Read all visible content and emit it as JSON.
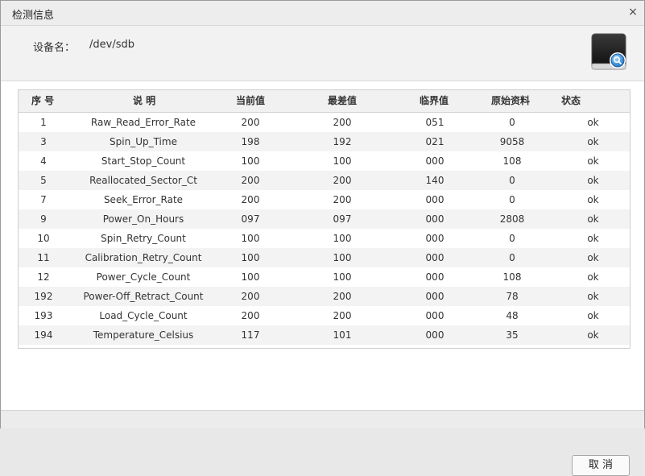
{
  "dialog": {
    "title": "检测信息",
    "close_icon": "×"
  },
  "device": {
    "label": "设备名：",
    "value": "/dev/sdb",
    "icon": "disk-search-icon"
  },
  "table": {
    "headers": [
      "序 号",
      "说 明",
      "当前值",
      "最差值",
      "临界值",
      "原始资料",
      "状态"
    ],
    "rows": [
      [
        "1",
        "Raw_Read_Error_Rate",
        "200",
        "200",
        "051",
        "0",
        "ok"
      ],
      [
        "3",
        "Spin_Up_Time",
        "198",
        "192",
        "021",
        "9058",
        "ok"
      ],
      [
        "4",
        "Start_Stop_Count",
        "100",
        "100",
        "000",
        "108",
        "ok"
      ],
      [
        "5",
        "Reallocated_Sector_Ct",
        "200",
        "200",
        "140",
        "0",
        "ok"
      ],
      [
        "7",
        "Seek_Error_Rate",
        "200",
        "200",
        "000",
        "0",
        "ok"
      ],
      [
        "9",
        "Power_On_Hours",
        "097",
        "097",
        "000",
        "2808",
        "ok"
      ],
      [
        "10",
        "Spin_Retry_Count",
        "100",
        "100",
        "000",
        "0",
        "ok"
      ],
      [
        "11",
        "Calibration_Retry_Count",
        "100",
        "100",
        "000",
        "0",
        "ok"
      ],
      [
        "12",
        "Power_Cycle_Count",
        "100",
        "100",
        "000",
        "108",
        "ok"
      ],
      [
        "192",
        "Power-Off_Retract_Count",
        "200",
        "200",
        "000",
        "78",
        "ok"
      ],
      [
        "193",
        "Load_Cycle_Count",
        "200",
        "200",
        "000",
        "48",
        "ok"
      ],
      [
        "194",
        "Temperature_Celsius",
        "117",
        "101",
        "000",
        "35",
        "ok"
      ]
    ]
  },
  "buttons": {
    "cancel": "取 消"
  }
}
